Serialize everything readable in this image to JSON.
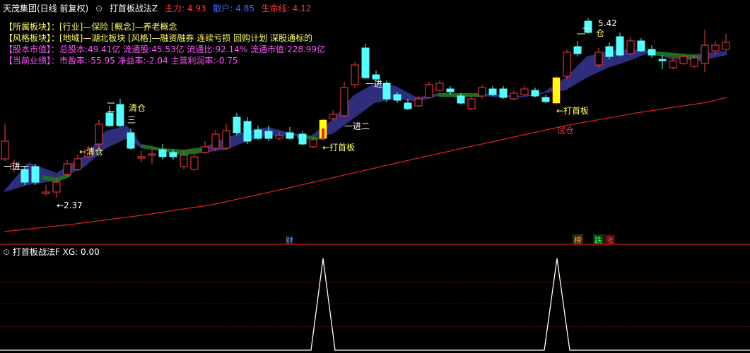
{
  "header": {
    "title": "天茂集团(日线 前复权)",
    "indicator": "打首板战法Z",
    "zhuli": "主力: 4.93",
    "sanhu": "散户: 4.85",
    "shengming": "生命线: 4.12"
  },
  "info": {
    "sector": "【所属板块】：[行业]—保险 [概念]—养老概念",
    "style": "【风格板块】：[地域]—湖北板块 [风格]—融资融券 连续亏损 回购计划 深股通标的",
    "equity": "【股本市值】：总股本:49.41亿 流通股:45.53亿 流通比:92.14% 流通市值:228.99亿",
    "perf": "【当前业绩】：市盈率:-55.95 净益率:-2.04 主营利润率:-0.75"
  },
  "annotations": {
    "low_price": "←2.37",
    "high_price": "5.42",
    "jin1_a": "一进一",
    "jin1_b": "一进一",
    "jin2": "一进二",
    "jin3": "三",
    "qingcang_1": "←清仓",
    "qingcang_2": "清仓",
    "qingcang_3": "仓",
    "dashouban_1": "←打首板",
    "dashouban_2": "←打首板",
    "shicang": "试仓"
  },
  "badges": {
    "cai": "财",
    "bang": "榜",
    "die": "跌",
    "zhang": "涨"
  },
  "lower_panel": {
    "title": "打首板战法F",
    "xg": "XG: 0.00"
  },
  "colors": {
    "up": "#ff3c3c",
    "down": "#54ffff",
    "band_bull": "#33338a",
    "band_bear": "#1e6e1e",
    "lifeline": "#e02020",
    "signal": "#ffff00",
    "yellow_text": "#ffff66",
    "magenta_text": "#ff55ff"
  },
  "chart_data": {
    "type": "candlestick",
    "low_marker": 2.37,
    "high_marker": 5.42,
    "signal_spikes": [
      {
        "at_candle": 39,
        "value": 1
      },
      {
        "at_candle": 69,
        "value": 1
      }
    ]
  }
}
